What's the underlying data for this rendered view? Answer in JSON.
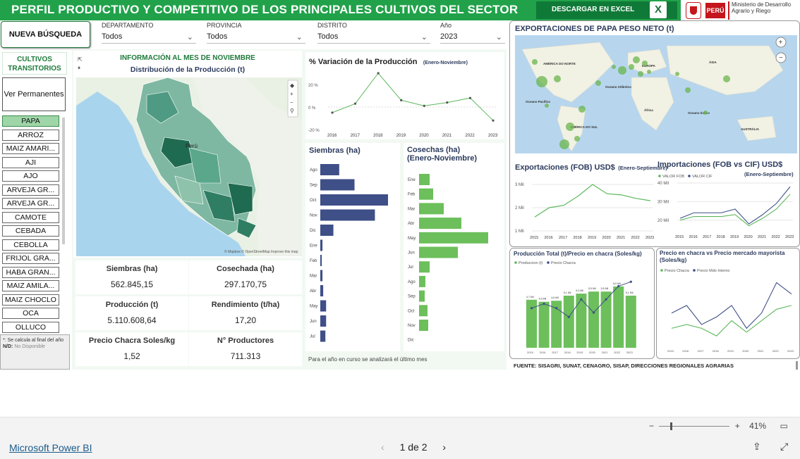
{
  "header": {
    "title": "PERFIL PRODUCTIVO Y COMPETITIVO DE LOS PRINCIPALES CULTIVOS DEL SECTOR",
    "download_label": "DESCARGAR EN EXCEL",
    "excel_icon_text": "X",
    "peru_label": "PERÚ",
    "ministry_label": "Ministerio de Desarrollo Agrario y Riego"
  },
  "filters": {
    "new_search": "NUEVA BÚSQUEDA",
    "departamento": {
      "label": "DEPARTAMENTO",
      "value": "Todos"
    },
    "provincia": {
      "label": "PROVINCIA",
      "value": "Todos"
    },
    "distrito": {
      "label": "DISTRITO",
      "value": "Todos"
    },
    "anio": {
      "label": "Año",
      "value": "2023"
    }
  },
  "left_panel": {
    "title": "CULTIVOS TRANSITORIOS",
    "toggle_button": "Ver Permanentes",
    "crops": [
      "PAPA",
      "ARROZ",
      "MAIZ AMARI...",
      "AJI",
      "AJO",
      "ARVEJA GR...",
      "ARVEJA GR...",
      "CAMOTE",
      "CEBADA",
      "CEBOLLA",
      "FRIJOL GRA...",
      "HABA GRAN...",
      "MAIZ AMILA...",
      "MAIZ CHOCLO",
      "OCA",
      "OLLUCO"
    ],
    "selected_crop": "PAPA",
    "note_line1": "*: Se calcula al final del año",
    "note_nd_label": "N/D:",
    "note_nd_text": "No Disponible"
  },
  "map_card": {
    "section": "INFORMACIÓN AL MES DE NOVIEMBRE",
    "title": "Distribución de la Producción (t)",
    "map_label_peru": "Perú",
    "attribution": "© Mapbox © OpenStreetMap Improve this map"
  },
  "kpis": {
    "siembras": {
      "label": "Siembras (ha)",
      "value": "562.845,15"
    },
    "cosechada": {
      "label": "Cosechada (ha)",
      "value": "297.170,75"
    },
    "produccion": {
      "label": "Producción (t)",
      "value": "5.110.608,64"
    },
    "rendimiento": {
      "label": "Rendimiento (t/ha)",
      "value": "17,20"
    },
    "precio": {
      "label": "Precio Chacra Soles/kg",
      "value": "1,52"
    },
    "productores": {
      "label": "N° Productores",
      "value": "711.313"
    }
  },
  "variation_chart": {
    "title": "% Variación de la Producción",
    "subtitle": "(Enero-Noviembre)"
  },
  "siembras_chart": {
    "title": "Siembras (ha)"
  },
  "cosechas_chart": {
    "title": "Cosechas (ha)",
    "subtitle": "(Enero-Noviembre)"
  },
  "footnote_mid": "Para el año en curso se analizará el último mes",
  "exports_map": {
    "title": "EXPORTACIONES DE PAPA PESO NETO (t)",
    "labels": [
      "AMÉRICA DO NORTE",
      "EUROPA",
      "ÁSIA",
      "África",
      "AMÉRICA DO SUL",
      "AUSTRÁLIA",
      "Oceano Atlântico",
      "Oceano Pacífico",
      "Oceano Índico"
    ]
  },
  "fob_chart": {
    "title": "Exportaciones (FOB) USD$",
    "subtitle": "(Enero-Septiembre)"
  },
  "imports_chart": {
    "title": "Importaciones (FOB vs CIF) USD$",
    "subtitle": "(Enero-Septiembre)",
    "legend": [
      "VALOR FOB",
      "VALOR CIF"
    ]
  },
  "prod_price_chart": {
    "title": "Producción Total (t)/Precio en chacra (Soles/kg)",
    "legend": [
      "Produccion (t)",
      "Precio Chacra"
    ]
  },
  "market_chart": {
    "title": "Precio en chacra vs Precio mercado mayorista (Soles/kg)",
    "legend": [
      "Precio Chacra",
      "Precio Mdo Interno"
    ]
  },
  "source": "FUENTE: SISAGRI, SUNAT, CENAGRO, SISAP, DIRECCIONES REGIONALES AGRARIAS",
  "footer": {
    "brand": "Microsoft Power BI",
    "page_indicator": "1 de 2",
    "zoom": "41%"
  },
  "colors": {
    "header_green": "#21a24a",
    "dark_green": "#0f7a37",
    "navy_bar": "#3f4f87",
    "green_bar": "#6cbf5b",
    "line_green": "#5cb85c",
    "navy_line": "#3f4f87"
  },
  "chart_data": [
    {
      "type": "line",
      "title": "% Variación de la Producción",
      "x": [
        "2016",
        "2017",
        "2018",
        "2019",
        "2020",
        "2021",
        "2022",
        "2023"
      ],
      "series": [
        {
          "values": [
            -5,
            3,
            30,
            6,
            1,
            4,
            8,
            -12
          ]
        }
      ],
      "ylim": [
        -20,
        30
      ],
      "yticks": [
        "20 %",
        "0 %",
        "-20 %"
      ]
    },
    {
      "type": "bar",
      "title": "Siembras (ha)",
      "orientation": "horizontal",
      "categories": [
        "Ago",
        "Sep",
        "Oct",
        "Nov",
        "Dic",
        "Ene",
        "Feb",
        "Mar",
        "Abr",
        "May",
        "Jun",
        "Jul"
      ],
      "values": [
        26,
        47,
        93,
        75,
        18,
        3,
        2,
        3,
        4,
        8,
        8,
        7
      ]
    },
    {
      "type": "bar",
      "title": "Cosechas (ha)",
      "orientation": "horizontal",
      "categories": [
        "Ene",
        "Feb",
        "Mar",
        "Abr",
        "May",
        "Jun",
        "Jul",
        "Ago",
        "Sep",
        "Oct",
        "Nov",
        "Dic"
      ],
      "values": [
        15,
        20,
        35,
        60,
        98,
        55,
        15,
        9,
        8,
        12,
        13,
        0
      ]
    },
    {
      "type": "line",
      "title": "Exportaciones (FOB) USD$",
      "x": [
        "2015",
        "2016",
        "2017",
        "2018",
        "2019",
        "2020",
        "2021",
        "2022",
        "2023"
      ],
      "series": [
        {
          "values": [
            1.6,
            2.0,
            2.1,
            2.5,
            3.0,
            2.6,
            2.55,
            2.4,
            2.3
          ]
        }
      ],
      "yticks": [
        "3 Mil",
        "2 Mil",
        "1 Mil"
      ]
    },
    {
      "type": "line",
      "title": "Importaciones (FOB vs CIF) USD$",
      "x": [
        "2015",
        "2016",
        "2017",
        "2018",
        "2019",
        "2020",
        "2021",
        "2022",
        "2023"
      ],
      "series": [
        {
          "name": "VALOR FOB",
          "values": [
            20,
            22,
            22,
            22,
            23,
            17,
            21,
            26,
            34
          ]
        },
        {
          "name": "VALOR CIF",
          "values": [
            21,
            24,
            24,
            24,
            26,
            18,
            23,
            29,
            38
          ]
        }
      ],
      "yticks": [
        "40 Mil",
        "30 Mil",
        "20 Mil"
      ]
    },
    {
      "type": "bar",
      "title": "Producción Total (t)/Precio en chacra (Soles/kg)",
      "categories": [
        "2015",
        "2016",
        "2017",
        "2018",
        "2019",
        "2020",
        "2021",
        "2022",
        "2023"
      ],
      "series": [
        {
          "name": "Produccion (t)",
          "values": [
            4.7,
            4.5,
            4.6,
            5.1,
            5.3,
            5.5,
            5.5,
            6.0,
            5.1
          ]
        },
        {
          "name": "Precio Chacra",
          "values": [
            0.9,
            1.0,
            0.9,
            0.7,
            1.1,
            0.8,
            1.1,
            1.4,
            1.5
          ]
        }
      ],
      "data_labels": [
        "4,7 Mil",
        "4,5 Mil",
        "4,6 Mil",
        "5,1 Mil",
        "5,3 Mil",
        "5,5 Mil",
        "5,5 Mil",
        "6,0 Mil",
        "5,1 Mil"
      ]
    },
    {
      "type": "line",
      "title": "Precio en chacra vs Precio mercado mayorista (Soles/kg)",
      "x": [
        "2015",
        "2016",
        "2017",
        "2018",
        "2019",
        "2020",
        "2021",
        "2022",
        "2023"
      ],
      "series": [
        {
          "name": "Precio Chacra",
          "values": [
            0.9,
            1.0,
            0.9,
            0.7,
            1.1,
            0.8,
            1.1,
            1.4,
            1.5
          ]
        },
        {
          "name": "Precio Mdo Interno",
          "values": [
            1.3,
            1.5,
            1.0,
            1.2,
            1.5,
            0.9,
            1.3,
            2.1,
            1.8
          ]
        }
      ]
    }
  ]
}
